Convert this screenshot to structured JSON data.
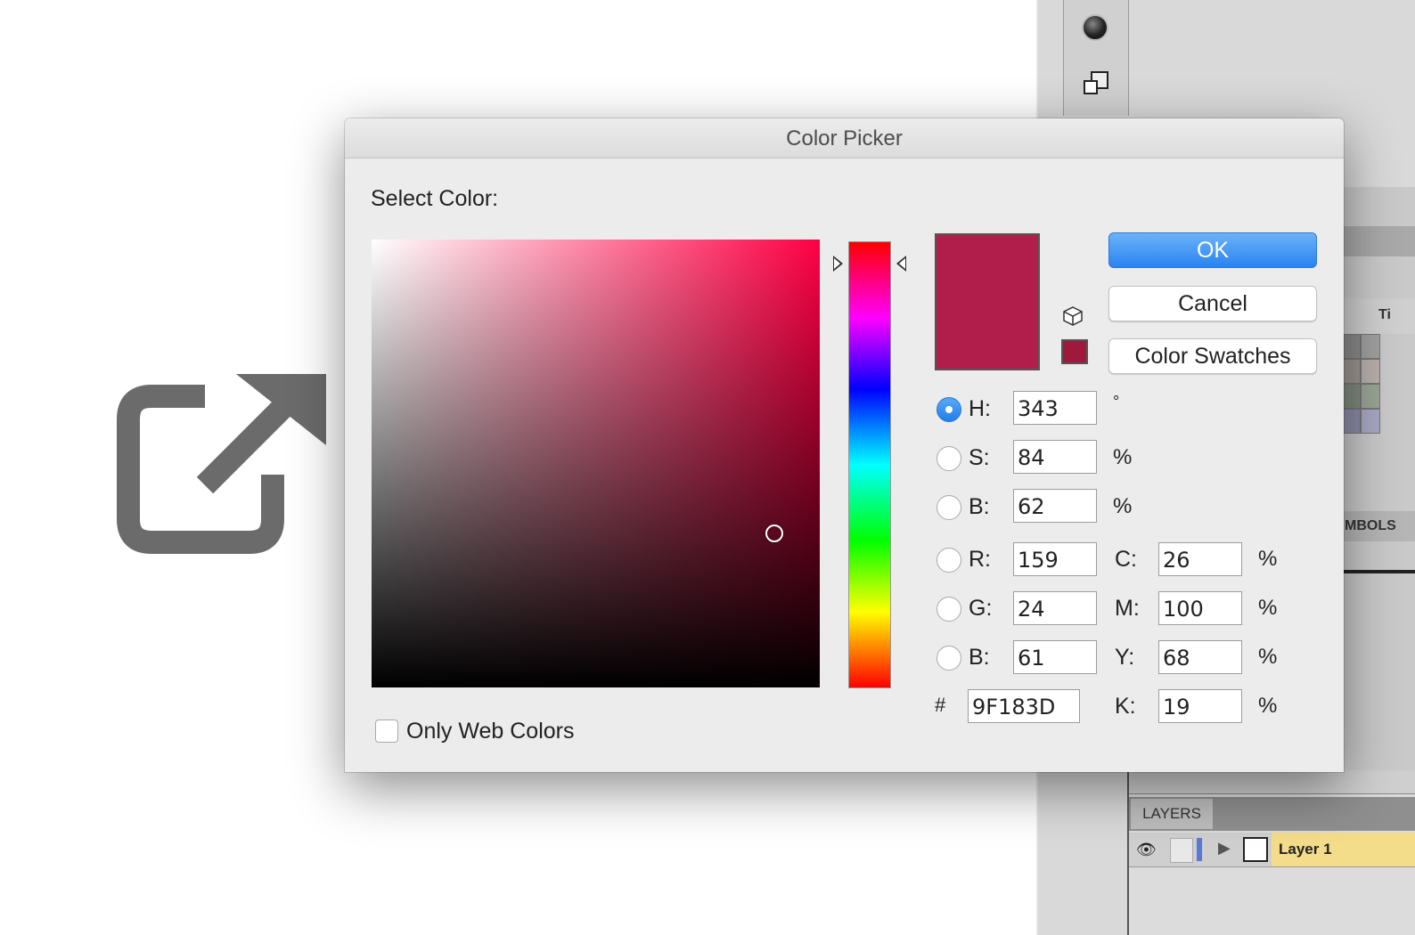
{
  "dialog": {
    "title": "Color Picker",
    "select_label": "Select Color:",
    "buttons": {
      "ok": "OK",
      "cancel": "Cancel",
      "swatches": "Color Swatches"
    },
    "only_web_colors": {
      "label": "Only Web Colors",
      "checked": false
    },
    "current_color": "#b21e4b",
    "web_safe_color": "#9f183d",
    "selected_mode": "H",
    "fields": {
      "H": {
        "label": "H:",
        "value": "343",
        "unit": "°"
      },
      "S": {
        "label": "S:",
        "value": "84",
        "unit": "%"
      },
      "Bri": {
        "label": "B:",
        "value": "62",
        "unit": "%"
      },
      "R": {
        "label": "R:",
        "value": "159"
      },
      "G": {
        "label": "G:",
        "value": "24"
      },
      "Blue": {
        "label": "B:",
        "value": "61"
      },
      "C": {
        "label": "C:",
        "value": "26",
        "unit": "%"
      },
      "M": {
        "label": "M:",
        "value": "100",
        "unit": "%"
      },
      "Y": {
        "label": "Y:",
        "value": "68",
        "unit": "%"
      },
      "K": {
        "label": "K:",
        "value": "19",
        "unit": "%"
      },
      "hex": {
        "label": "#",
        "value": "9F183D"
      }
    }
  },
  "background_app": {
    "panel_labels": {
      "ti": "Ti",
      "symbols": "MBOLS"
    },
    "layers_panel": {
      "tab": "LAYERS",
      "layer_name": "Layer 1"
    }
  },
  "icons": {
    "share": "external-link-icon",
    "record": "record-icon",
    "stack": "layers-stack-icon",
    "cube": "cube-icon",
    "eye": "eye-icon"
  },
  "colors": {
    "share_icon": "#6b6b6b",
    "ok_button": "#2a83f0",
    "layer_highlight": "#f3dc8a"
  }
}
